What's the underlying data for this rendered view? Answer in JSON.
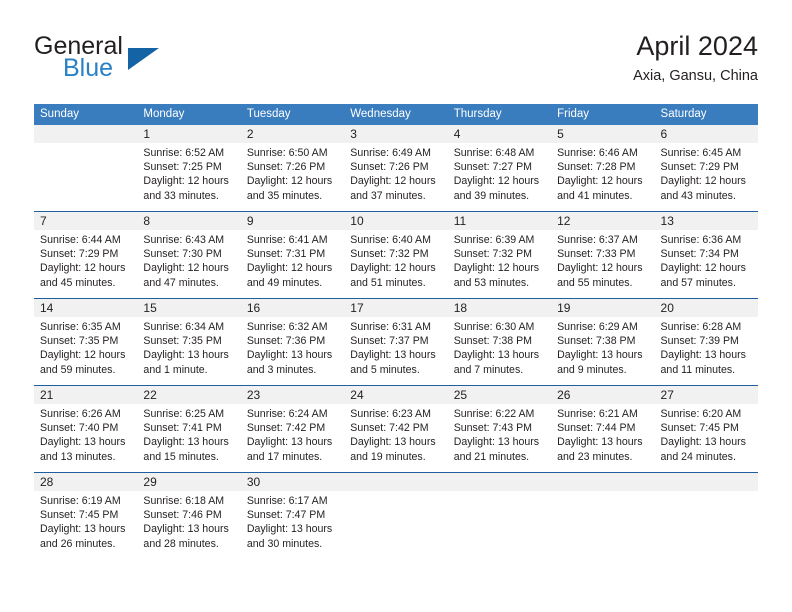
{
  "brand": {
    "name_top": "General",
    "name_bottom": "Blue",
    "triangle_color": "#1464a5",
    "blue_color": "#2980c4"
  },
  "header": {
    "title": "April 2024",
    "subtitle": "Axia, Gansu, China"
  },
  "colors": {
    "header_row_bg": "#3a7dbe",
    "daynum_bg": "#f1f1f1",
    "week_divider": "#1f5fa0",
    "text": "#231f20"
  },
  "weekdays": [
    "Sunday",
    "Monday",
    "Tuesday",
    "Wednesday",
    "Thursday",
    "Friday",
    "Saturday"
  ],
  "weeks": [
    {
      "days": [
        {
          "num": "",
          "sunrise": "",
          "sunset": "",
          "daylight1": "",
          "daylight2": ""
        },
        {
          "num": "1",
          "sunrise": "Sunrise: 6:52 AM",
          "sunset": "Sunset: 7:25 PM",
          "daylight1": "Daylight: 12 hours",
          "daylight2": "and 33 minutes."
        },
        {
          "num": "2",
          "sunrise": "Sunrise: 6:50 AM",
          "sunset": "Sunset: 7:26 PM",
          "daylight1": "Daylight: 12 hours",
          "daylight2": "and 35 minutes."
        },
        {
          "num": "3",
          "sunrise": "Sunrise: 6:49 AM",
          "sunset": "Sunset: 7:26 PM",
          "daylight1": "Daylight: 12 hours",
          "daylight2": "and 37 minutes."
        },
        {
          "num": "4",
          "sunrise": "Sunrise: 6:48 AM",
          "sunset": "Sunset: 7:27 PM",
          "daylight1": "Daylight: 12 hours",
          "daylight2": "and 39 minutes."
        },
        {
          "num": "5",
          "sunrise": "Sunrise: 6:46 AM",
          "sunset": "Sunset: 7:28 PM",
          "daylight1": "Daylight: 12 hours",
          "daylight2": "and 41 minutes."
        },
        {
          "num": "6",
          "sunrise": "Sunrise: 6:45 AM",
          "sunset": "Sunset: 7:29 PM",
          "daylight1": "Daylight: 12 hours",
          "daylight2": "and 43 minutes."
        }
      ]
    },
    {
      "days": [
        {
          "num": "7",
          "sunrise": "Sunrise: 6:44 AM",
          "sunset": "Sunset: 7:29 PM",
          "daylight1": "Daylight: 12 hours",
          "daylight2": "and 45 minutes."
        },
        {
          "num": "8",
          "sunrise": "Sunrise: 6:43 AM",
          "sunset": "Sunset: 7:30 PM",
          "daylight1": "Daylight: 12 hours",
          "daylight2": "and 47 minutes."
        },
        {
          "num": "9",
          "sunrise": "Sunrise: 6:41 AM",
          "sunset": "Sunset: 7:31 PM",
          "daylight1": "Daylight: 12 hours",
          "daylight2": "and 49 minutes."
        },
        {
          "num": "10",
          "sunrise": "Sunrise: 6:40 AM",
          "sunset": "Sunset: 7:32 PM",
          "daylight1": "Daylight: 12 hours",
          "daylight2": "and 51 minutes."
        },
        {
          "num": "11",
          "sunrise": "Sunrise: 6:39 AM",
          "sunset": "Sunset: 7:32 PM",
          "daylight1": "Daylight: 12 hours",
          "daylight2": "and 53 minutes."
        },
        {
          "num": "12",
          "sunrise": "Sunrise: 6:37 AM",
          "sunset": "Sunset: 7:33 PM",
          "daylight1": "Daylight: 12 hours",
          "daylight2": "and 55 minutes."
        },
        {
          "num": "13",
          "sunrise": "Sunrise: 6:36 AM",
          "sunset": "Sunset: 7:34 PM",
          "daylight1": "Daylight: 12 hours",
          "daylight2": "and 57 minutes."
        }
      ]
    },
    {
      "days": [
        {
          "num": "14",
          "sunrise": "Sunrise: 6:35 AM",
          "sunset": "Sunset: 7:35 PM",
          "daylight1": "Daylight: 12 hours",
          "daylight2": "and 59 minutes."
        },
        {
          "num": "15",
          "sunrise": "Sunrise: 6:34 AM",
          "sunset": "Sunset: 7:35 PM",
          "daylight1": "Daylight: 13 hours",
          "daylight2": "and 1 minute."
        },
        {
          "num": "16",
          "sunrise": "Sunrise: 6:32 AM",
          "sunset": "Sunset: 7:36 PM",
          "daylight1": "Daylight: 13 hours",
          "daylight2": "and 3 minutes."
        },
        {
          "num": "17",
          "sunrise": "Sunrise: 6:31 AM",
          "sunset": "Sunset: 7:37 PM",
          "daylight1": "Daylight: 13 hours",
          "daylight2": "and 5 minutes."
        },
        {
          "num": "18",
          "sunrise": "Sunrise: 6:30 AM",
          "sunset": "Sunset: 7:38 PM",
          "daylight1": "Daylight: 13 hours",
          "daylight2": "and 7 minutes."
        },
        {
          "num": "19",
          "sunrise": "Sunrise: 6:29 AM",
          "sunset": "Sunset: 7:38 PM",
          "daylight1": "Daylight: 13 hours",
          "daylight2": "and 9 minutes."
        },
        {
          "num": "20",
          "sunrise": "Sunrise: 6:28 AM",
          "sunset": "Sunset: 7:39 PM",
          "daylight1": "Daylight: 13 hours",
          "daylight2": "and 11 minutes."
        }
      ]
    },
    {
      "days": [
        {
          "num": "21",
          "sunrise": "Sunrise: 6:26 AM",
          "sunset": "Sunset: 7:40 PM",
          "daylight1": "Daylight: 13 hours",
          "daylight2": "and 13 minutes."
        },
        {
          "num": "22",
          "sunrise": "Sunrise: 6:25 AM",
          "sunset": "Sunset: 7:41 PM",
          "daylight1": "Daylight: 13 hours",
          "daylight2": "and 15 minutes."
        },
        {
          "num": "23",
          "sunrise": "Sunrise: 6:24 AM",
          "sunset": "Sunset: 7:42 PM",
          "daylight1": "Daylight: 13 hours",
          "daylight2": "and 17 minutes."
        },
        {
          "num": "24",
          "sunrise": "Sunrise: 6:23 AM",
          "sunset": "Sunset: 7:42 PM",
          "daylight1": "Daylight: 13 hours",
          "daylight2": "and 19 minutes."
        },
        {
          "num": "25",
          "sunrise": "Sunrise: 6:22 AM",
          "sunset": "Sunset: 7:43 PM",
          "daylight1": "Daylight: 13 hours",
          "daylight2": "and 21 minutes."
        },
        {
          "num": "26",
          "sunrise": "Sunrise: 6:21 AM",
          "sunset": "Sunset: 7:44 PM",
          "daylight1": "Daylight: 13 hours",
          "daylight2": "and 23 minutes."
        },
        {
          "num": "27",
          "sunrise": "Sunrise: 6:20 AM",
          "sunset": "Sunset: 7:45 PM",
          "daylight1": "Daylight: 13 hours",
          "daylight2": "and 24 minutes."
        }
      ]
    },
    {
      "days": [
        {
          "num": "28",
          "sunrise": "Sunrise: 6:19 AM",
          "sunset": "Sunset: 7:45 PM",
          "daylight1": "Daylight: 13 hours",
          "daylight2": "and 26 minutes."
        },
        {
          "num": "29",
          "sunrise": "Sunrise: 6:18 AM",
          "sunset": "Sunset: 7:46 PM",
          "daylight1": "Daylight: 13 hours",
          "daylight2": "and 28 minutes."
        },
        {
          "num": "30",
          "sunrise": "Sunrise: 6:17 AM",
          "sunset": "Sunset: 7:47 PM",
          "daylight1": "Daylight: 13 hours",
          "daylight2": "and 30 minutes."
        },
        {
          "num": "",
          "sunrise": "",
          "sunset": "",
          "daylight1": "",
          "daylight2": ""
        },
        {
          "num": "",
          "sunrise": "",
          "sunset": "",
          "daylight1": "",
          "daylight2": ""
        },
        {
          "num": "",
          "sunrise": "",
          "sunset": "",
          "daylight1": "",
          "daylight2": ""
        },
        {
          "num": "",
          "sunrise": "",
          "sunset": "",
          "daylight1": "",
          "daylight2": ""
        }
      ]
    }
  ]
}
